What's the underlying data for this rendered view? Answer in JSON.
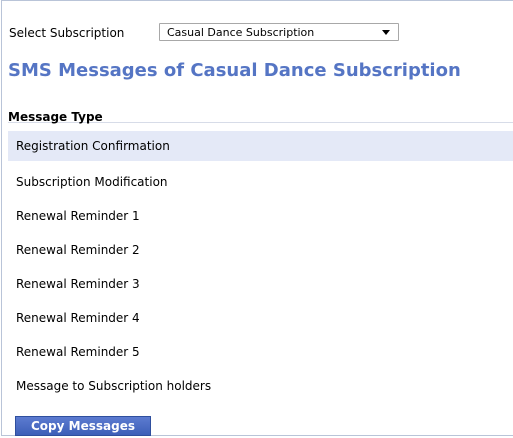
{
  "select": {
    "label": "Select Subscription",
    "value": "Casual Dance Subscription"
  },
  "title": "SMS Messages of Casual Dance Subscription",
  "table": {
    "header": "Message Type",
    "rows": [
      {
        "label": "Registration Confirmation",
        "selected": true
      },
      {
        "label": "Subscription Modification",
        "selected": false
      },
      {
        "label": "Renewal Reminder 1",
        "selected": false
      },
      {
        "label": "Renewal Reminder 2",
        "selected": false
      },
      {
        "label": "Renewal Reminder 3",
        "selected": false
      },
      {
        "label": "Renewal Reminder 4",
        "selected": false
      },
      {
        "label": "Renewal Reminder 5",
        "selected": false
      },
      {
        "label": "Message to Subscription holders",
        "selected": false
      }
    ]
  },
  "actions": {
    "copy_label": "Copy Messages"
  },
  "colors": {
    "title": "#5575c4",
    "selected_row": "#e4e9f7",
    "button": "#4466bf"
  }
}
